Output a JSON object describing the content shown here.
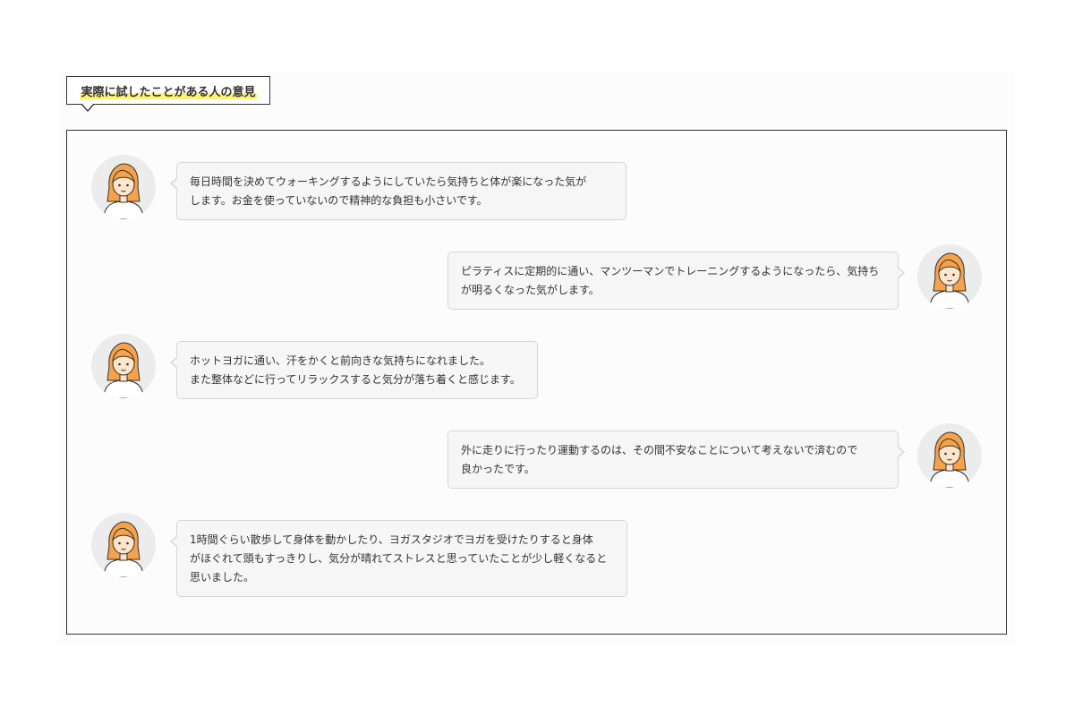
{
  "heading": {
    "title": "実際に試したことがある人の意見"
  },
  "colors": {
    "highlight": "#fff176",
    "hair": "#f6a24a",
    "avatar_bg": "#ececec",
    "bubble_bg": "#f6f6f6",
    "border": "#333333"
  },
  "avatar_icon": "woman-avatar-icon",
  "comments": [
    {
      "side": "left",
      "lines": [
        "毎日時間を決めてウォーキングするようにしていたら気持ちと体が楽になった気が",
        "します。お金を使っていないので精神的な負担も小さいです。"
      ]
    },
    {
      "side": "right",
      "lines": [
        "ピラティスに定期的に通い、マンツーマンでトレーニングするようになったら、気持ち",
        "が明るくなった気がします。"
      ]
    },
    {
      "side": "left",
      "lines": [
        "ホットヨガに通い、汗をかくと前向きな気持ちになれました。",
        "また整体などに行ってリラックスすると気分が落ち着くと感じます。"
      ]
    },
    {
      "side": "right",
      "lines": [
        "外に走りに行ったり運動するのは、その間不安なことについて考えないで済むので",
        "良かったです。"
      ]
    },
    {
      "side": "left",
      "lines": [
        "1時間ぐらい散歩して身体を動かしたり、ヨガスタジオでヨガを受けたりすると身体",
        "がほぐれて頭もすっきりし、気分が晴れてストレスと思っていたことが少し軽くなると",
        "思いました。"
      ]
    }
  ]
}
